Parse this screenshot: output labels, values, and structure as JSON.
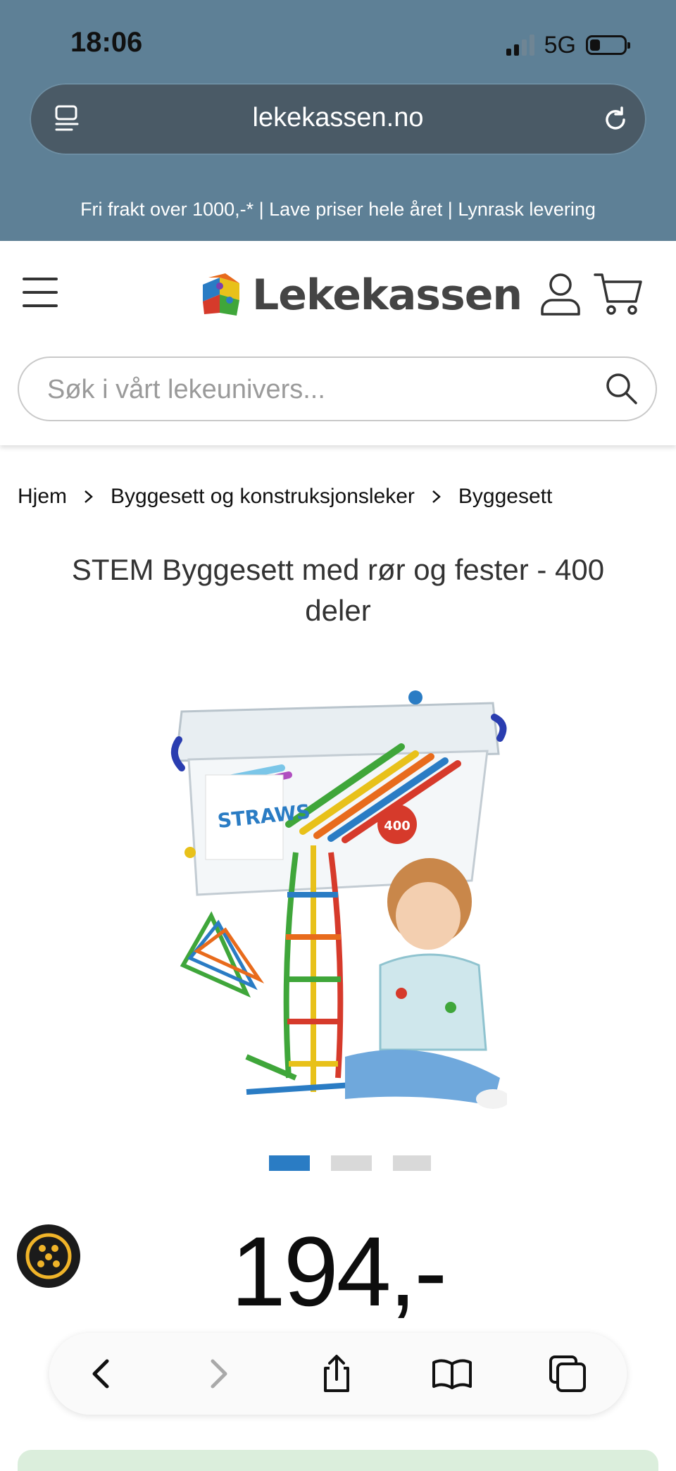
{
  "status_bar": {
    "time": "18:06",
    "network": "5G"
  },
  "browser": {
    "url": "lekekassen.no"
  },
  "promo_bar": {
    "text": "Fri frakt over 1000,-* | Lave priser hele året | Lynrask levering"
  },
  "header": {
    "logo_text": "Lekekassen",
    "search_placeholder": "Søk i vårt lekeunivers..."
  },
  "breadcrumb": [
    "Hjem",
    "Byggesett og konstruksjonsleker",
    "Byggesett"
  ],
  "product": {
    "title": "STEM Byggesett med rør og fester - 400 deler",
    "image_labels": {
      "brand": "STRAWS",
      "count": "400"
    },
    "price": "194,-",
    "carousel": {
      "count": 3,
      "active_index": 0
    }
  },
  "colors": {
    "top_area": "#5e8096",
    "accent_blue": "#2a7cc4",
    "text_dark": "#333333"
  },
  "icons": [
    "url-page-icon",
    "reload-icon",
    "menu-icon",
    "user-icon",
    "cart-icon",
    "search-icon",
    "chevron-right-icon",
    "cookie-icon",
    "back-icon",
    "forward-icon",
    "share-icon",
    "bookmarks-icon",
    "tabs-icon"
  ]
}
